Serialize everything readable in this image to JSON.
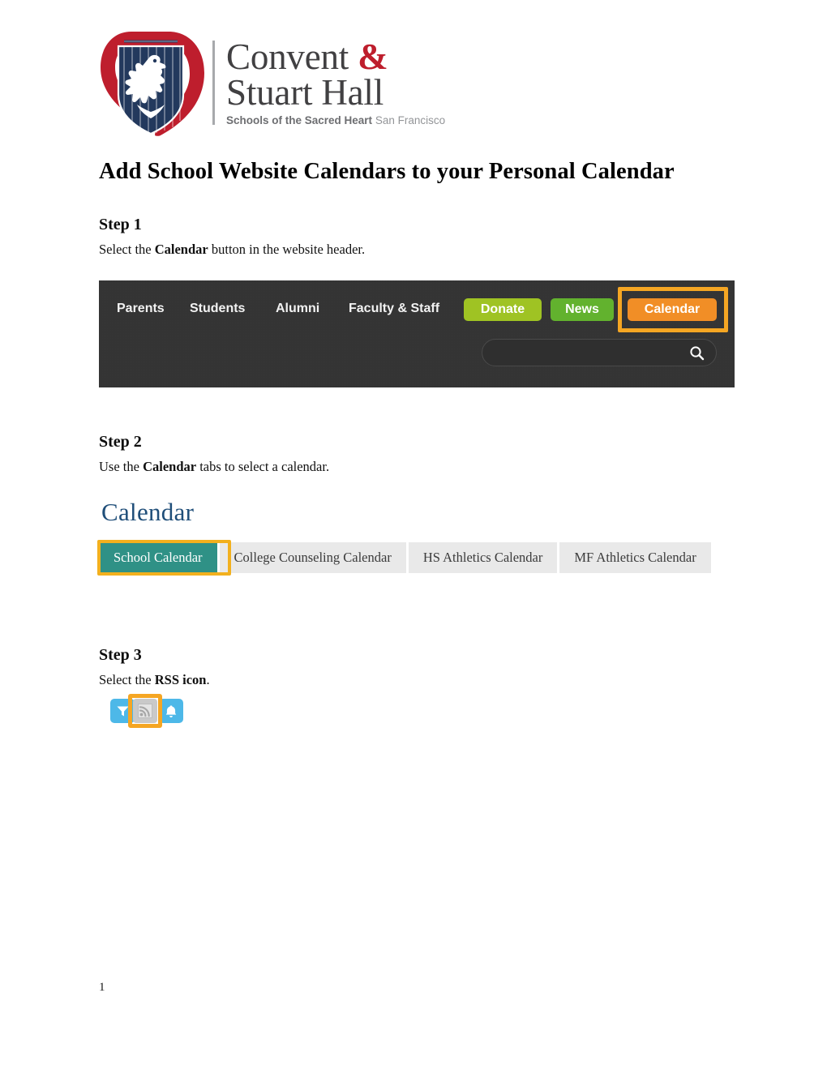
{
  "document": {
    "title": "Add School Website Calendars to your Personal Calendar",
    "page_number": "1"
  },
  "logo": {
    "line1_text": "Convent ",
    "ampersand": "&",
    "line2_text": "Stuart Hall",
    "tagline_bold": "Schools of the Sacred Heart",
    "tagline_light": " San Francisco",
    "shield_icon": "shield-lion-crest-icon",
    "colors": {
      "red": "#be1e2d",
      "navy": "#23395d",
      "wordmark_gray": "#414042",
      "tagline_gray": "#808285"
    }
  },
  "steps": [
    {
      "heading": "Step 1",
      "body_before": "Select the ",
      "body_bold": "Calendar",
      "body_after": " button in the website header."
    },
    {
      "heading": "Step 2",
      "body_before": "Use the ",
      "body_bold": "Calendar",
      "body_after": " tabs to select a calendar."
    },
    {
      "heading": "Step 3",
      "body_before": "Select the ",
      "body_bold": "RSS icon",
      "body_after": "."
    }
  ],
  "screenshot_navbar": {
    "links": [
      "Parents",
      "Students",
      "Alumni",
      "Faculty & Staff"
    ],
    "buttons": [
      {
        "label": "Donate",
        "color": "#9fc323"
      },
      {
        "label": "News",
        "color": "#62b22e"
      },
      {
        "label": "Calendar",
        "color": "#f18e26",
        "highlighted": true
      }
    ],
    "search": {
      "value": "",
      "placeholder": "",
      "icon": "search-icon"
    },
    "background_color": "#333333",
    "highlight_color": "#f5a623"
  },
  "screenshot_calendar_tabs": {
    "heading": "Calendar",
    "heading_color": "#1f4e79",
    "tabs": [
      {
        "label": "School Calendar",
        "active": true,
        "highlighted": true
      },
      {
        "label": "College Counseling Calendar",
        "active": false,
        "highlighted": false
      },
      {
        "label": "HS Athletics Calendar",
        "active": false,
        "highlighted": false
      },
      {
        "label": "MF Athletics Calendar",
        "active": false,
        "highlighted": false
      }
    ],
    "active_color": "#2f9186",
    "inactive_color": "#e9e9e9",
    "highlight_color": "#f2b01e"
  },
  "screenshot_icon_row": {
    "icons": [
      {
        "name": "filter-icon",
        "color": "#4db8e8",
        "highlighted": false
      },
      {
        "name": "rss-icon",
        "color": "#c9c9c9",
        "highlighted": true
      },
      {
        "name": "bell-icon",
        "color": "#4db8e8",
        "highlighted": false
      }
    ],
    "highlight_color": "#f5a623"
  }
}
